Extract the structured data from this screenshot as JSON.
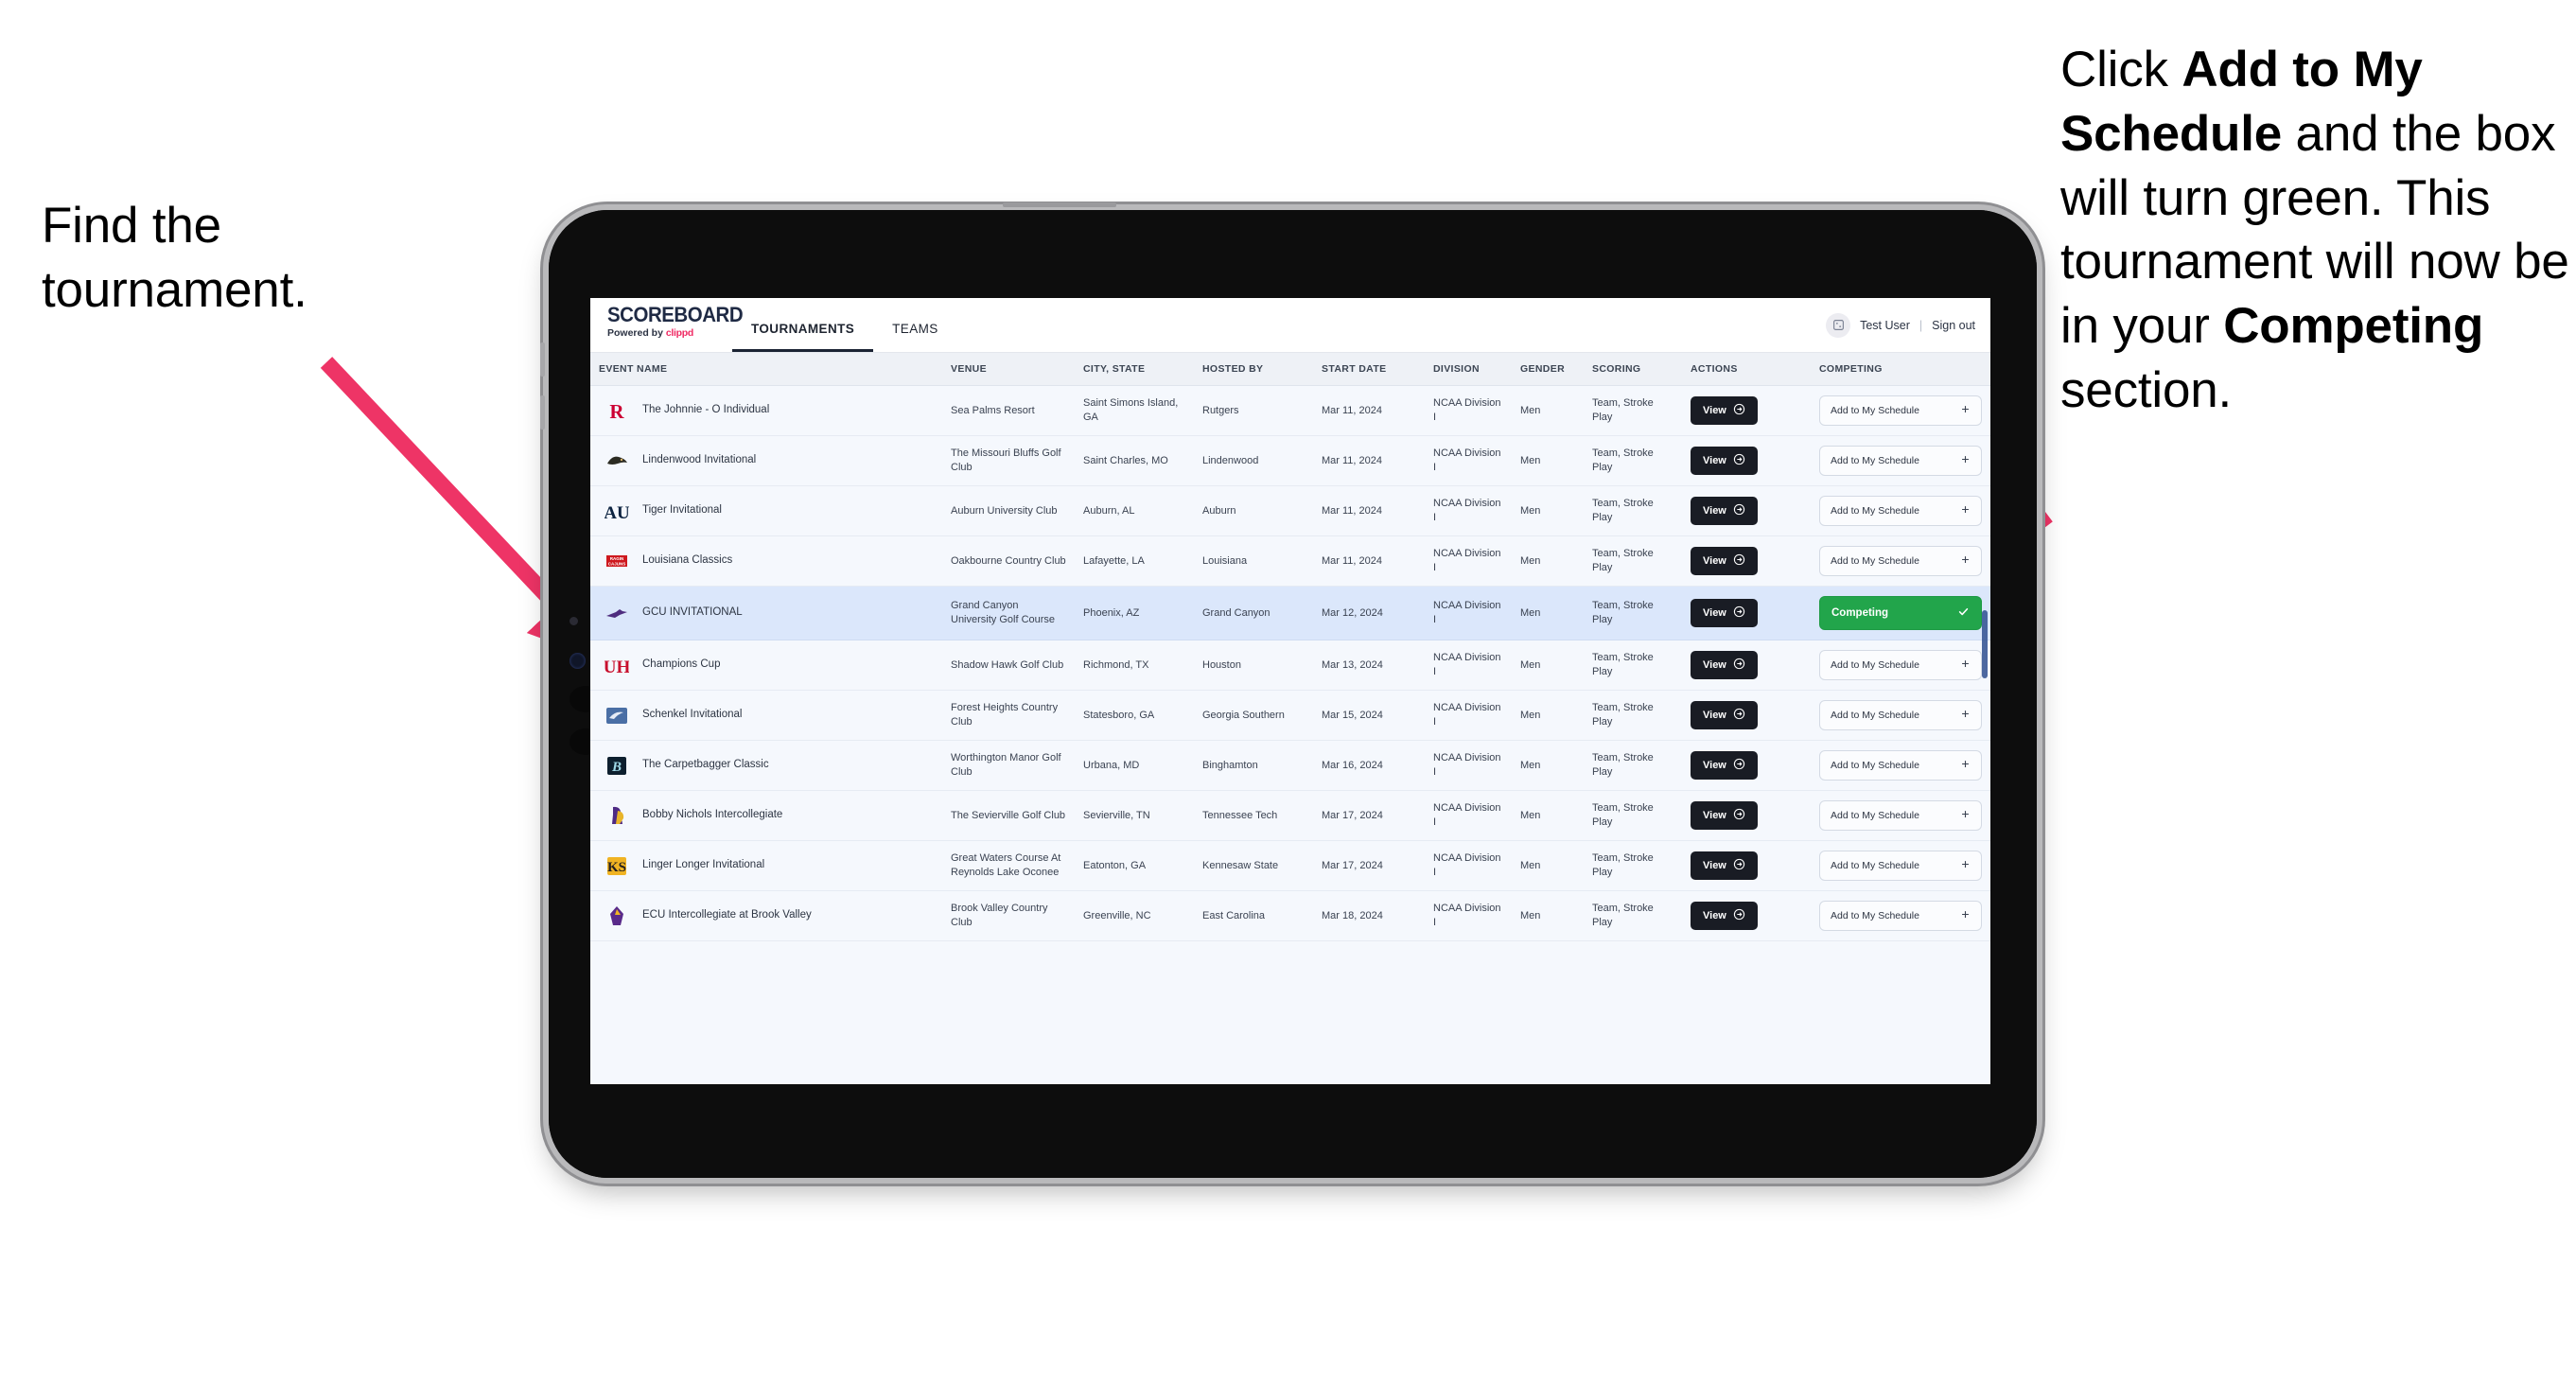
{
  "annotations": {
    "left": "Find the tournament.",
    "right_parts": [
      {
        "text": "Click ",
        "bold": false
      },
      {
        "text": "Add to My Schedule",
        "bold": true
      },
      {
        "text": " and the box will turn green. This tournament will now be in your ",
        "bold": false
      },
      {
        "text": "Competing",
        "bold": true
      },
      {
        "text": " section.",
        "bold": false
      }
    ],
    "arrow_color": "#ee3466"
  },
  "app": {
    "logo": {
      "word": "SCOREBOARD",
      "powered_prefix": "Powered by ",
      "brand": "clippd"
    },
    "nav": [
      {
        "label": "TOURNAMENTS",
        "active": true
      },
      {
        "label": "TEAMS",
        "active": false
      }
    ],
    "user": {
      "avatar_icon": "user-avatar-icon",
      "name": "Test User",
      "separator": "|",
      "sign_out": "Sign out"
    }
  },
  "table": {
    "columns": [
      "EVENT NAME",
      "VENUE",
      "CITY, STATE",
      "HOSTED BY",
      "START DATE",
      "DIVISION",
      "GENDER",
      "SCORING",
      "ACTIONS",
      "COMPETING"
    ],
    "labels": {
      "view": "View",
      "add": "Add to My Schedule",
      "add_icon": "plus-icon",
      "competing": "Competing",
      "competing_icon": "check-icon",
      "view_icon": "arrow-right-circle-icon"
    },
    "rows": [
      {
        "logo": "rutgers-logo",
        "event": "The Johnnie - O Individual",
        "venue": "Sea Palms Resort",
        "city": "Saint Simons Island, GA",
        "host": "Rutgers",
        "date": "Mar 11, 2024",
        "division": "NCAA Division I",
        "gender": "Men",
        "scoring": "Team, Stroke Play",
        "competing": false,
        "selected": false
      },
      {
        "logo": "lindenwood-logo",
        "event": "Lindenwood Invitational",
        "venue": "The Missouri Bluffs Golf Club",
        "city": "Saint Charles, MO",
        "host": "Lindenwood",
        "date": "Mar 11, 2024",
        "division": "NCAA Division I",
        "gender": "Men",
        "scoring": "Team, Stroke Play",
        "competing": false,
        "selected": false
      },
      {
        "logo": "auburn-logo",
        "event": "Tiger Invitational",
        "venue": "Auburn University Club",
        "city": "Auburn, AL",
        "host": "Auburn",
        "date": "Mar 11, 2024",
        "division": "NCAA Division I",
        "gender": "Men",
        "scoring": "Team, Stroke Play",
        "competing": false,
        "selected": false
      },
      {
        "logo": "louisiana-logo",
        "event": "Louisiana Classics",
        "venue": "Oakbourne Country Club",
        "city": "Lafayette, LA",
        "host": "Louisiana",
        "date": "Mar 11, 2024",
        "division": "NCAA Division I",
        "gender": "Men",
        "scoring": "Team, Stroke Play",
        "competing": false,
        "selected": false
      },
      {
        "logo": "grand-canyon-logo",
        "event": "GCU INVITATIONAL",
        "venue": "Grand Canyon University Golf Course",
        "city": "Phoenix, AZ",
        "host": "Grand Canyon",
        "date": "Mar 12, 2024",
        "division": "NCAA Division I",
        "gender": "Men",
        "scoring": "Team, Stroke Play",
        "competing": true,
        "selected": true
      },
      {
        "logo": "houston-logo",
        "event": "Champions Cup",
        "venue": "Shadow Hawk Golf Club",
        "city": "Richmond, TX",
        "host": "Houston",
        "date": "Mar 13, 2024",
        "division": "NCAA Division I",
        "gender": "Men",
        "scoring": "Team, Stroke Play",
        "competing": false,
        "selected": false
      },
      {
        "logo": "georgia-southern-logo",
        "event": "Schenkel Invitational",
        "venue": "Forest Heights Country Club",
        "city": "Statesboro, GA",
        "host": "Georgia Southern",
        "date": "Mar 15, 2024",
        "division": "NCAA Division I",
        "gender": "Men",
        "scoring": "Team, Stroke Play",
        "competing": false,
        "selected": false
      },
      {
        "logo": "binghamton-logo",
        "event": "The Carpetbagger Classic",
        "venue": "Worthington Manor Golf Club",
        "city": "Urbana, MD",
        "host": "Binghamton",
        "date": "Mar 16, 2024",
        "division": "NCAA Division I",
        "gender": "Men",
        "scoring": "Team, Stroke Play",
        "competing": false,
        "selected": false
      },
      {
        "logo": "tennessee-tech-logo",
        "event": "Bobby Nichols Intercollegiate",
        "venue": "The Sevierville Golf Club",
        "city": "Sevierville, TN",
        "host": "Tennessee Tech",
        "date": "Mar 17, 2024",
        "division": "NCAA Division I",
        "gender": "Men",
        "scoring": "Team, Stroke Play",
        "competing": false,
        "selected": false
      },
      {
        "logo": "kennesaw-state-logo",
        "event": "Linger Longer Invitational",
        "venue": "Great Waters Course At Reynolds Lake Oconee",
        "city": "Eatonton, GA",
        "host": "Kennesaw State",
        "date": "Mar 17, 2024",
        "division": "NCAA Division I",
        "gender": "Men",
        "scoring": "Team, Stroke Play",
        "competing": false,
        "selected": false
      },
      {
        "logo": "ecu-logo",
        "event": "ECU Intercollegiate at Brook Valley",
        "venue": "Brook Valley Country Club",
        "city": "Greenville, NC",
        "host": "East Carolina",
        "date": "Mar 18, 2024",
        "division": "NCAA Division I",
        "gender": "Men",
        "scoring": "Team, Stroke Play",
        "competing": false,
        "selected": false
      }
    ]
  },
  "colors": {
    "accent_pink": "#ee3466",
    "competing_green": "#22a54b",
    "dark_button": "#191c24",
    "selected_row": "#dbe7fb",
    "row_bg": "#f5f8fd",
    "header_bg": "#eef1f6"
  }
}
